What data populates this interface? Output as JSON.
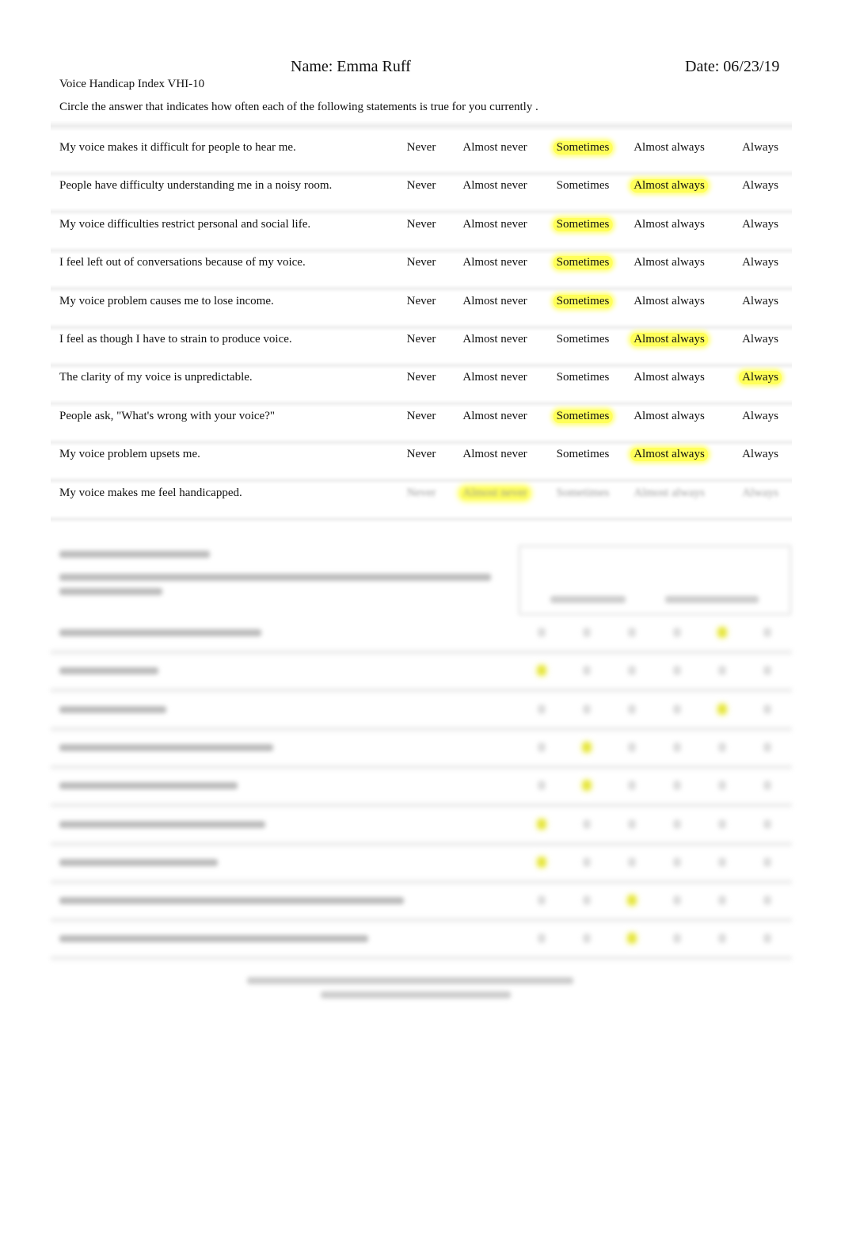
{
  "header": {
    "name": "Name: Emma Ruff",
    "date": "Date: 06/23/19"
  },
  "form": {
    "title": "Voice Handicap Index VHI-10",
    "instructions": "Circle the answer that indicates how often each of the following statements is true for you currently .",
    "options": [
      "Never",
      "Almost never",
      "Sometimes",
      "Almost always",
      "Always"
    ],
    "highlight_color": "#ffff5a",
    "items": [
      {
        "statement": "My voice makes it difficult for people to hear me.",
        "selected": 2
      },
      {
        "statement": "People have difficulty understanding me in a noisy room.",
        "selected": 3
      },
      {
        "statement": "My voice difficulties restrict personal and social life.",
        "selected": 2
      },
      {
        "statement": "I feel left out of conversations because of my voice.",
        "selected": 2
      },
      {
        "statement": "My voice problem causes me to lose income.",
        "selected": 2
      },
      {
        "statement": "I feel as though I have to strain to produce voice.",
        "selected": 3
      },
      {
        "statement": "The clarity of my voice is unpredictable.",
        "selected": 4
      },
      {
        "statement": "People ask, \"What's wrong with your voice?\"",
        "selected": 2
      },
      {
        "statement": "My voice problem upsets me.",
        "selected": 3
      },
      {
        "statement": "My voice makes me feel handicapped.",
        "selected": 1,
        "options_blurred": true
      }
    ]
  },
  "blurred_section": {
    "rating_selected": [
      4,
      0,
      4,
      1,
      1,
      0,
      0,
      2,
      2
    ]
  }
}
